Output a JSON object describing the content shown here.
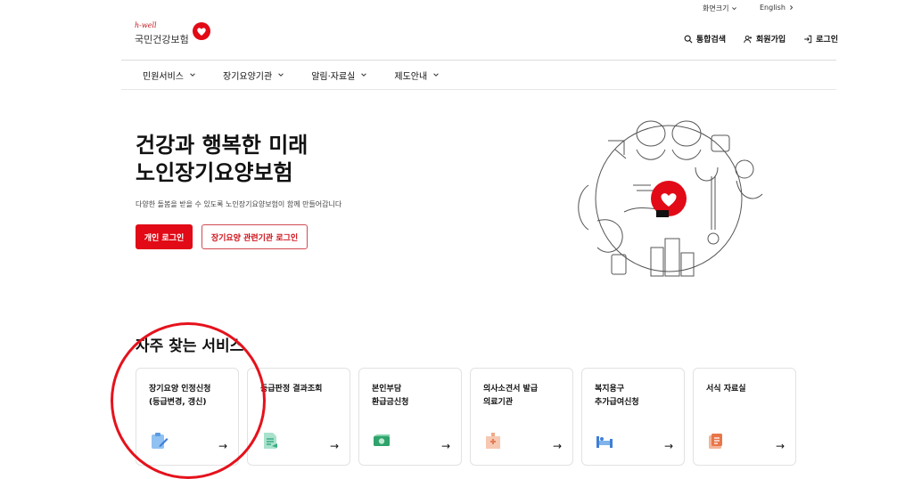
{
  "utility": {
    "font_size": "화면크기",
    "language": "English"
  },
  "logo": {
    "sub": "h-well",
    "name": "국민건강보험"
  },
  "header": {
    "search": "통합검색",
    "signup": "회원가입",
    "login": "로그인"
  },
  "gnb": [
    {
      "label": "민원서비스"
    },
    {
      "label": "장기요양기관"
    },
    {
      "label": "알림·자료실"
    },
    {
      "label": "제도안내"
    }
  ],
  "hero": {
    "title_line1": "건강과 행복한 미래",
    "title_line2": "노인장기요양보험",
    "description": "다양한 돌봄을 받을 수 있도록 노인장기요양보험이 함께 만들어갑니다",
    "btn_personal": "개인 로그인",
    "btn_institution": "장기요양 관련기관 로그인"
  },
  "services": {
    "title": "자주 찾는 서비스",
    "cards": [
      {
        "label": "장기요양 인정신청\n(등급변경, 갱신)",
        "icon": "application-icon",
        "color": "#6aa9e9"
      },
      {
        "label": "등급판정 결과조회",
        "icon": "document-icon",
        "color": "#5cc6a3"
      },
      {
        "label": "본인부담\n환급금신청",
        "icon": "money-icon",
        "color": "#2fa36b"
      },
      {
        "label": "의사소견서 발급\n의료기관",
        "icon": "hospital-icon",
        "color": "#f0a988"
      },
      {
        "label": "복지용구\n추가급여신청",
        "icon": "bed-icon",
        "color": "#4e8fdc"
      },
      {
        "label": "서식 자료실",
        "icon": "form-icon",
        "color": "#e8764a"
      }
    ],
    "arrow": "→"
  },
  "colors": {
    "brand": "#e10a16",
    "annotation": "#e5121c"
  }
}
